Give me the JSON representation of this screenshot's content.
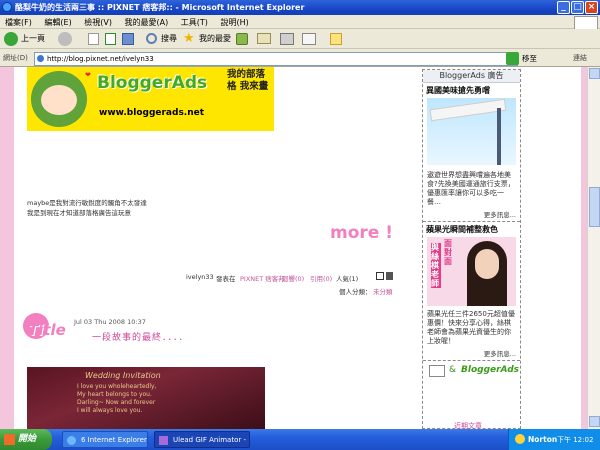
{
  "window": {
    "title": "酪梨牛奶的生活兩三事 :: PIXNET 痞客邦:: - Microsoft Internet Explorer"
  },
  "menu": [
    "檔案(F)",
    "編輯(E)",
    "檢視(V)",
    "我的最愛(A)",
    "工具(T)",
    "說明(H)"
  ],
  "toolbar": {
    "back": "上一頁",
    "search": "搜尋",
    "favorites": "我的最愛"
  },
  "address": {
    "label": "網址(D)",
    "url": "http://blog.pixnet.net/ivelyn33",
    "go": "移至",
    "links": "連結"
  },
  "banner": {
    "brand": "BloggerAds",
    "url": "www.bloggerads.net",
    "slogan": "我的部落格 我來畫"
  },
  "post1": {
    "line1": "maybe是我對流行敏銳度的觸角不太發達",
    "line2": "我是到現在才知道部落格廣告這玩意",
    "more": "more !",
    "meta_author": "ivelyn33",
    "meta_posted": "發表在",
    "meta_site": "PIXNET 痞客邦",
    "meta_items": [
      "迴響(0)",
      "引用(0)",
      "人氣(1)"
    ],
    "category_label": "個人分類：",
    "category": "未分類"
  },
  "post2": {
    "date": "Jul 03 Thu 2008 10:37",
    "title_tag": "Title",
    "title": "一段故事的最終．．．．",
    "photo_lines": [
      "Wedding Invitation",
      "I love you wholeheartedly,",
      "My heart belongs to you.",
      "Darling~ Now and forever",
      "I will always love you."
    ]
  },
  "sidebar": {
    "header": "BloggerAds 廣告",
    "ad1": {
      "title": "異國美味搶先勇嚐",
      "text": "遨遊世界想盡興嚐遍各地美食?先換美國運通旅行支票，優惠匯率讓你可以多吃一餐…",
      "more": "更多訊息..."
    },
    "ad2": {
      "title": "蘋果光瞬間補整救色",
      "sign1": "與絲棋老師",
      "sign2": "面對面",
      "text": "蘋果光任三件2650元超值優惠價！快來分享心得，絲棋老師會為蘋果光資優生的你上妝喔！",
      "more": "更多訊息..."
    },
    "footer_brand": "BloggerAds",
    "footer_next": "近期文章"
  },
  "taskbar": {
    "start": "開始",
    "tasks": [
      "6 Internet Explorer",
      "Ulead GIF Animator - ..."
    ],
    "norton": "Norton",
    "time": "下午 12:02"
  }
}
